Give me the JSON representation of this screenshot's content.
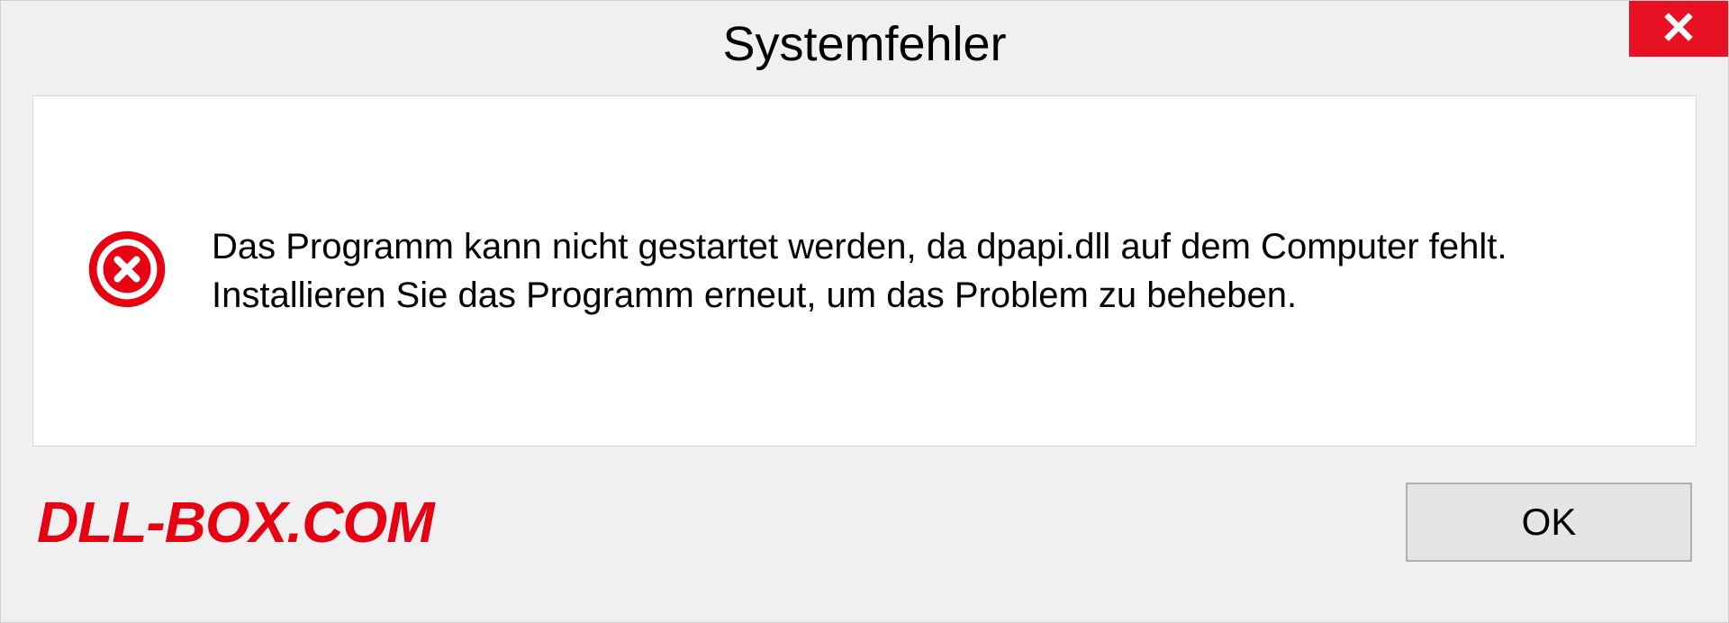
{
  "dialog": {
    "title": "Systemfehler",
    "message": "Das Programm kann nicht gestartet werden, da dpapi.dll auf dem Computer fehlt. Installieren Sie das Programm erneut, um das Problem zu beheben.",
    "ok_label": "OK"
  },
  "watermark": "DLL-BOX.COM",
  "colors": {
    "close_button": "#e81123",
    "error_icon": "#e60012",
    "watermark": "#e60012"
  }
}
